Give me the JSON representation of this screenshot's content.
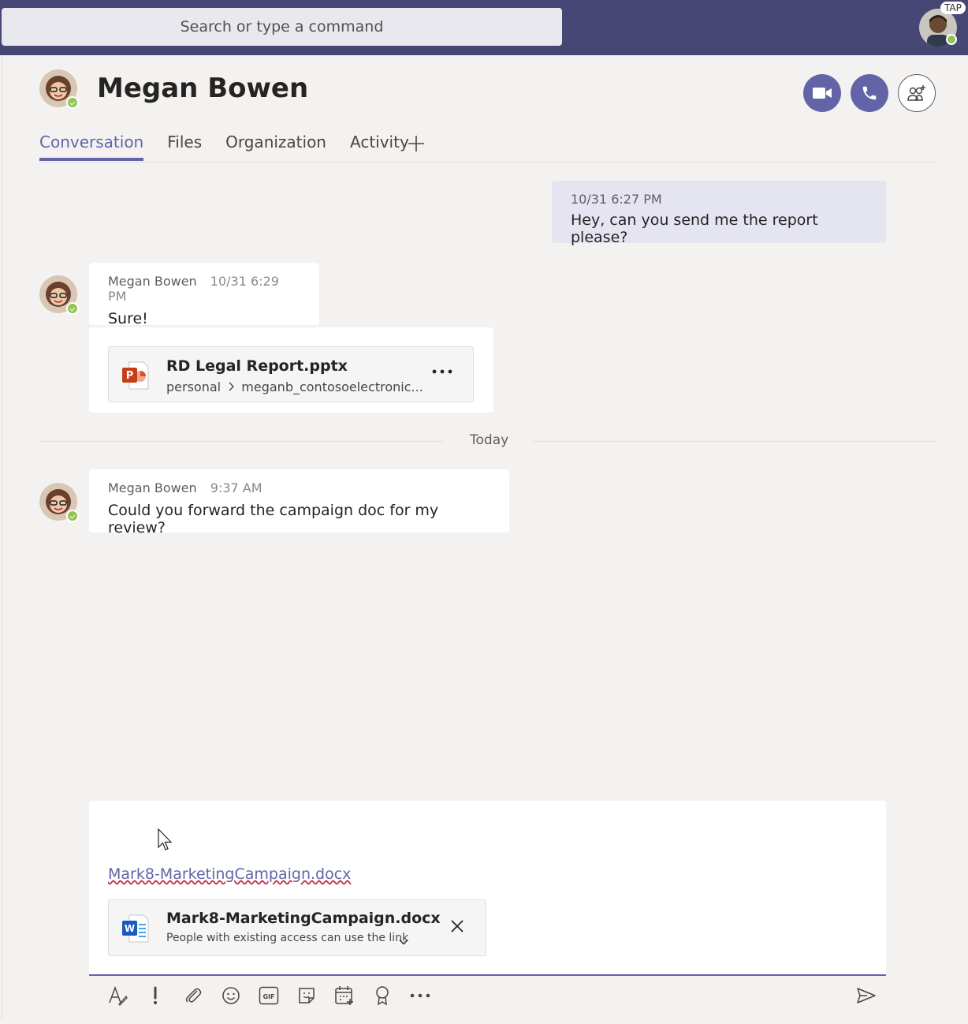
{
  "search": {
    "placeholder": "Search or type a command"
  },
  "profile": {
    "badge": "TAP"
  },
  "header": {
    "name": "Megan Bowen"
  },
  "tabs": [
    {
      "label": "Conversation"
    },
    {
      "label": "Files"
    },
    {
      "label": "Organization"
    },
    {
      "label": "Activity"
    }
  ],
  "messages": {
    "mine": {
      "timestamp": "10/31 6:27 PM",
      "text": "Hey, can you send me the report please?"
    },
    "reply1": {
      "author": "Megan Bowen",
      "timestamp": "10/31 6:29 PM",
      "text": "Sure!"
    },
    "file1": {
      "name": "RD Legal Report.pptx",
      "path_root": "personal",
      "path_rest": "meganb_contosoelectronic..."
    },
    "divider": "Today",
    "reply2": {
      "author": "Megan Bowen",
      "timestamp": "9:37 AM",
      "text": "Could you forward the campaign doc for my review?"
    }
  },
  "compose": {
    "link_text": "Mark8-MarketingCampaign.docx",
    "attachment": {
      "name": "Mark8-MarketingCampaign.docx",
      "permission": "People with existing access can use the link"
    }
  },
  "colors": {
    "brand": "#6264a7",
    "topbar": "#464775",
    "presence": "#92c353"
  }
}
